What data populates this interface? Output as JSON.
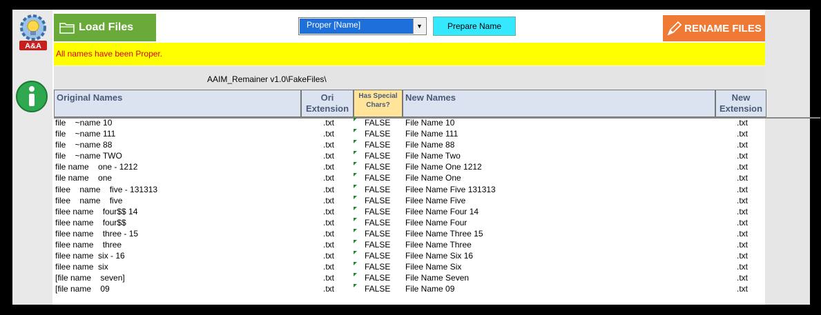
{
  "logo": {
    "text": "A&A",
    "icon": "gear-bulb-logo"
  },
  "toolbar": {
    "load_label": "Load Files",
    "dropdown_value": "Proper [Name]",
    "prepare_label": "Prepare Name",
    "rename_label": "RENAME FILES"
  },
  "status": {
    "message": "All names have been Proper."
  },
  "path": {
    "text": "AAIM_Remainer v1.0\\FakeFiles\\"
  },
  "table": {
    "headers": {
      "original": "Original Names",
      "ori_ext_1": "Ori",
      "ori_ext_2": "Extension",
      "special_1": "Has Special",
      "special_2": "Chars?",
      "new_names": "New Names",
      "new_ext_1": "New",
      "new_ext_2": "Extension"
    },
    "rows": [
      {
        "orig": "file    ~name 10",
        "ext": ".txt",
        "special": "FALSE",
        "newname": "File Name 10",
        "newext": ".txt"
      },
      {
        "orig": "file    ~name 111",
        "ext": ".txt",
        "special": "FALSE",
        "newname": "File Name 111",
        "newext": ".txt"
      },
      {
        "orig": "file    ~name 88",
        "ext": ".txt",
        "special": "FALSE",
        "newname": "File Name 88",
        "newext": ".txt"
      },
      {
        "orig": "file    ~name TWO",
        "ext": ".txt",
        "special": "FALSE",
        "newname": "File Name Two",
        "newext": ".txt"
      },
      {
        "orig": "file name    one - 1212",
        "ext": ".txt",
        "special": "FALSE",
        "newname": "File Name One 1212",
        "newext": ".txt"
      },
      {
        "orig": "file name    one",
        "ext": ".txt",
        "special": "FALSE",
        "newname": "File Name One",
        "newext": ".txt"
      },
      {
        "orig": "filee    name    five - 131313",
        "ext": ".txt",
        "special": "FALSE",
        "newname": "Filee Name Five 131313",
        "newext": ".txt"
      },
      {
        "orig": "filee    name    five",
        "ext": ".txt",
        "special": "FALSE",
        "newname": "Filee Name Five",
        "newext": ".txt"
      },
      {
        "orig": "filee name    four$$ 14",
        "ext": ".txt",
        "special": "FALSE",
        "newname": "Filee Name Four 14",
        "newext": ".txt"
      },
      {
        "orig": "filee name    four$$",
        "ext": ".txt",
        "special": "FALSE",
        "newname": "Filee Name Four",
        "newext": ".txt"
      },
      {
        "orig": "filee name    three - 15",
        "ext": ".txt",
        "special": "FALSE",
        "newname": "Filee Name Three 15",
        "newext": ".txt"
      },
      {
        "orig": "filee name    three",
        "ext": ".txt",
        "special": "FALSE",
        "newname": "Filee Name Three",
        "newext": ".txt"
      },
      {
        "orig": "filee name  six - 16",
        "ext": ".txt",
        "special": "FALSE",
        "newname": "Filee Name Six 16",
        "newext": ".txt"
      },
      {
        "orig": "filee name  six",
        "ext": ".txt",
        "special": "FALSE",
        "newname": "Filee Name Six",
        "newext": ".txt"
      },
      {
        "orig": "[file name    seven]",
        "ext": ".txt",
        "special": "FALSE",
        "newname": "File Name Seven",
        "newext": ".txt"
      },
      {
        "orig": "[file name    09",
        "ext": ".txt",
        "special": "FALSE",
        "newname": "File Name 09",
        "newext": ".txt"
      }
    ]
  },
  "colors": {
    "load_button": "#6aaa3a",
    "prepare_button": "#33e8ff",
    "rename_button": "#ef7a36",
    "status_bg": "#ffff00",
    "status_text": "#e00000",
    "header_bg": "#dbe3f1",
    "special_header_bg": "#ffe49a"
  }
}
